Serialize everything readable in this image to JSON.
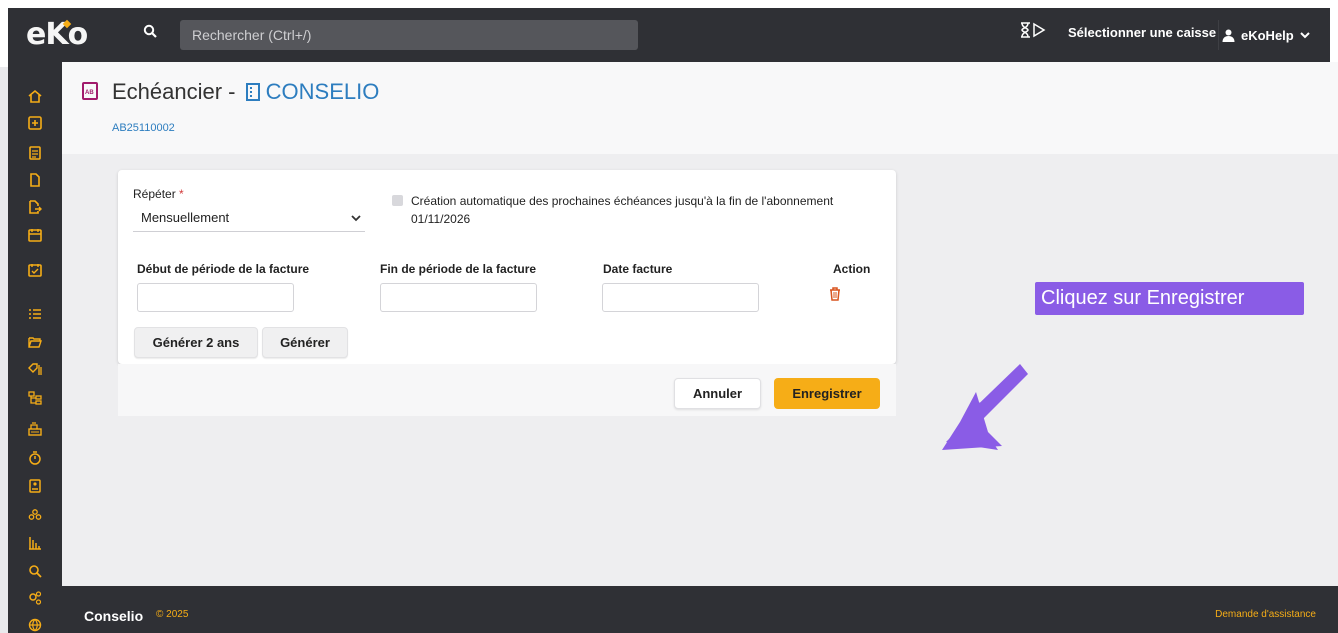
{
  "app": {
    "logo": "eko",
    "search_placeholder": "Rechercher (Ctrl+/)",
    "select_caisse_label": "Sélectionner une caisse",
    "user_name": "eKoHelp"
  },
  "sidebar": {
    "icons": [
      "home-icon",
      "add-box-icon",
      "list-doc-icon",
      "file-icon",
      "file-export-icon",
      "calendar-icon",
      "calendar-check-icon",
      "checklist-icon",
      "folder-open-icon",
      "tags-icon",
      "hierarchy-icon",
      "cash-register-icon",
      "stopwatch-icon",
      "contact-card-icon",
      "users-group-icon",
      "bar-chart-icon",
      "search-icon",
      "settings-icon",
      "globe-icon"
    ]
  },
  "page": {
    "title_prefix": "Echéancier -",
    "company": "CONSELIO",
    "reference": "AB25110002"
  },
  "form": {
    "repeat_label": "Répéter",
    "repeat_required_mark": "*",
    "repeat_value": "Mensuellement",
    "auto_create_label": "Création automatique des prochaines échéances jusqu'à la fin de l'abonnement",
    "auto_create_date": "01/11/2026",
    "auto_create_checked": false,
    "columns": {
      "start": "Début de période de la facture",
      "end": "Fin de période de la facture",
      "date": "Date facture",
      "action": "Action"
    },
    "row": {
      "start": "",
      "end": "",
      "date": ""
    },
    "generate_2y_label": "Générer 2 ans",
    "generate_label": "Générer"
  },
  "actions": {
    "cancel_label": "Annuler",
    "save_label": "Enregistrer"
  },
  "annotation": {
    "text": "Cliquez sur Enregistrer"
  },
  "footer": {
    "brand": "Conselio",
    "copyright": "© 2025",
    "assistance": "Demande d'assistance"
  },
  "colors": {
    "accent": "#f6ad17",
    "dark": "#2f3035",
    "link": "#2d7dbf",
    "callout": "#8a5ce6"
  }
}
